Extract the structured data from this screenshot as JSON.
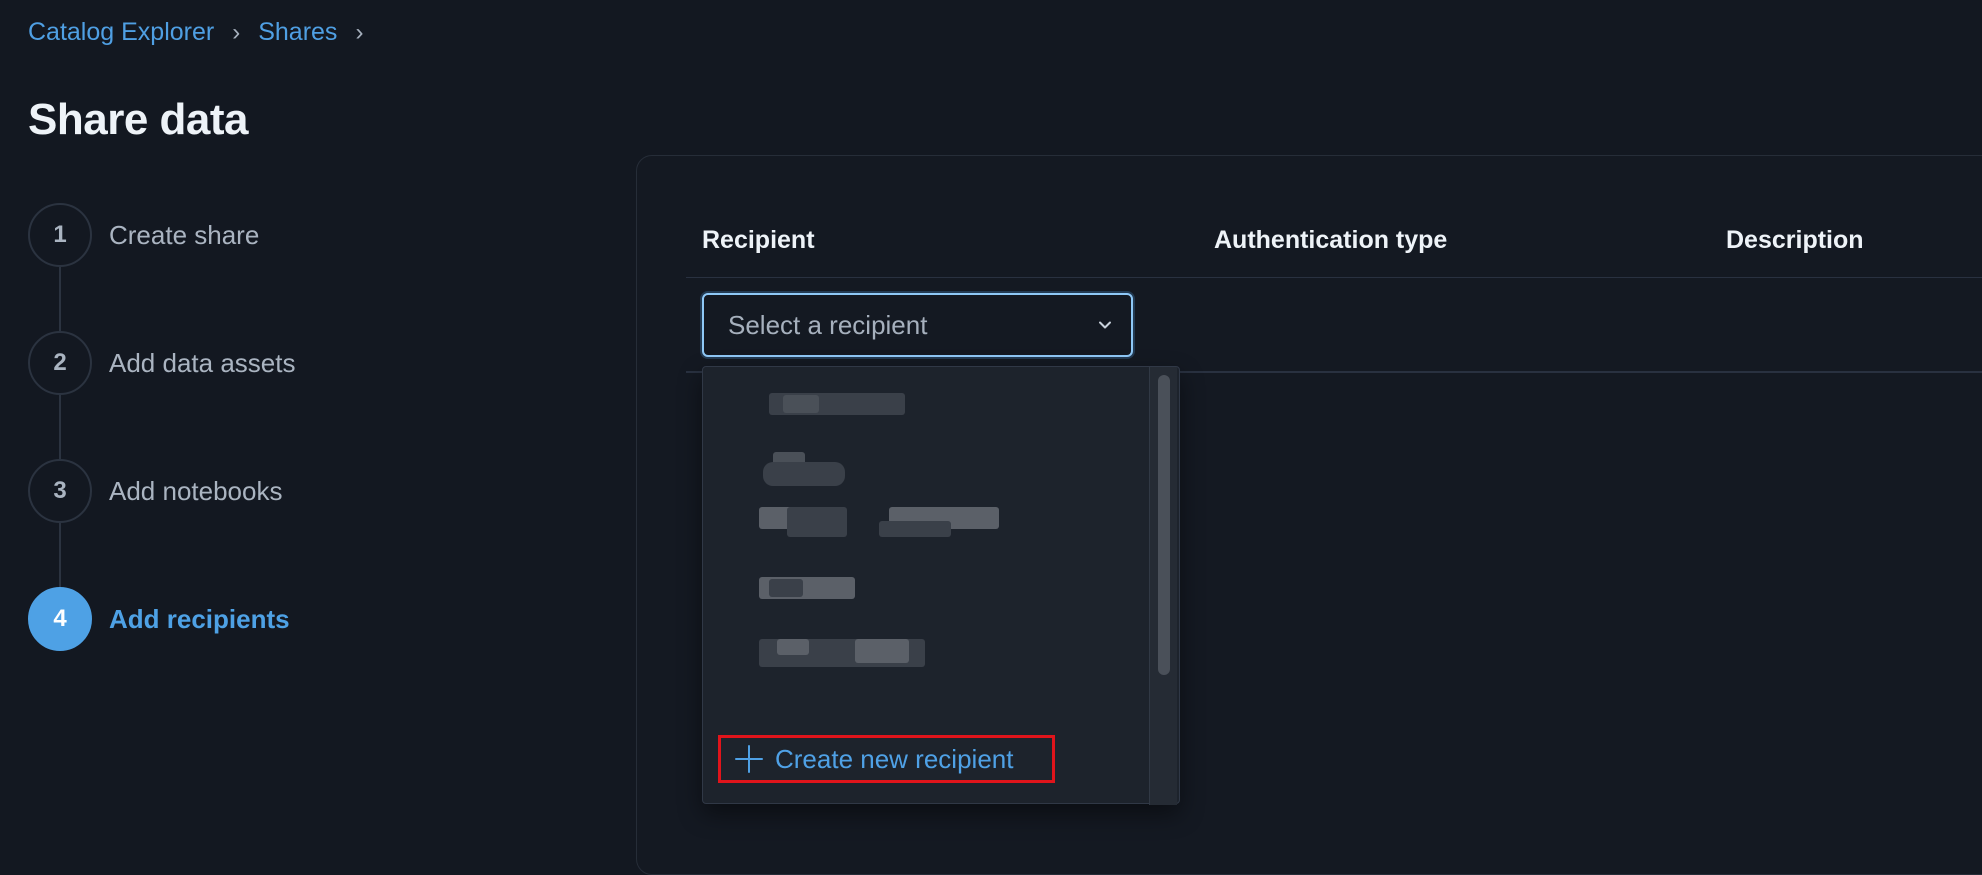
{
  "breadcrumb": {
    "items": [
      "Catalog Explorer",
      "Shares"
    ],
    "separator": "›"
  },
  "page": {
    "title": "Share data"
  },
  "steps": [
    {
      "number": "1",
      "label": "Create share",
      "active": false
    },
    {
      "number": "2",
      "label": "Add data assets",
      "active": false
    },
    {
      "number": "3",
      "label": "Add notebooks",
      "active": false
    },
    {
      "number": "4",
      "label": "Add recipients",
      "active": true
    }
  ],
  "table": {
    "headers": [
      "Recipient",
      "Authentication type",
      "Description"
    ]
  },
  "recipient_select": {
    "placeholder": "Select a recipient",
    "icon": "chevron-down-icon"
  },
  "dropdown": {
    "create_label": "Create new recipient",
    "create_icon": "plus-icon"
  },
  "colors": {
    "background": "#131821",
    "accent": "#4ea1e5",
    "highlight_box": "#e0141b",
    "text": "#eef3f8",
    "muted": "#aab4c1"
  }
}
